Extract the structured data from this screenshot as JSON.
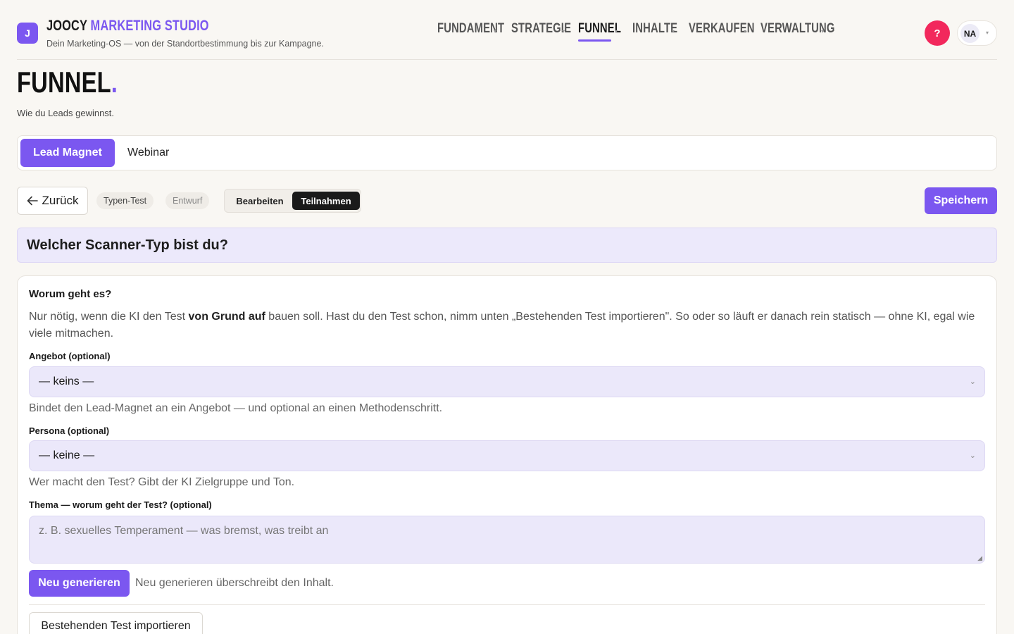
{
  "header": {
    "logo_letter": "J",
    "brand_part1": "Joocy",
    "brand_part2": "Marketing Studio",
    "subtitle": "Dein Marketing-OS — von der Standortbestimmung bis zur Kampagne.",
    "nav": [
      "Fundament",
      "Strategie",
      "Funnel",
      "Inhalte",
      "Verkaufen",
      "Verwaltung"
    ],
    "active_nav": "Funnel",
    "help_label": "?",
    "user_initials": "NA"
  },
  "page": {
    "title": "Funnel",
    "title_dot": ".",
    "subtitle": "Wie du Leads gewinnst."
  },
  "tabs": {
    "items": [
      "Lead Magnet",
      "Webinar"
    ],
    "active": "Lead Magnet"
  },
  "toolbar": {
    "back_label": "Zurück",
    "type_pill": "Typen-Test",
    "status_pill": "Entwurf",
    "segment": [
      "Bearbeiten",
      "Teilnahmen"
    ],
    "segment_active": "Teilnahmen",
    "save_label": "Speichern"
  },
  "question": {
    "title": "Welcher Scanner-Typ bist du?"
  },
  "card": {
    "title": "Worum geht es?",
    "desc_part1": "Nur nötig, wenn die KI den Test ",
    "desc_bold": "von Grund auf",
    "desc_part2": " bauen soll. Hast du den Test schon, nimm unten „Bestehenden Test importieren\". So oder so läuft er danach rein statisch — ohne KI, egal wie viele mitmachen.",
    "offer_label": "Angebot (optional)",
    "offer_value": "— keins —",
    "offer_hint": "Bindet den Lead-Magnet an ein Angebot — und optional an einen Methodenschritt.",
    "persona_label": "Persona (optional)",
    "persona_value": "— keine —",
    "persona_hint": "Wer macht den Test? Gibt der KI Zielgruppe und Ton.",
    "topic_label": "Thema — worum geht der Test? (optional)",
    "topic_placeholder": "z. B. sexuelles Temperament — was bremst, was treibt an",
    "generate_label": "Neu generieren",
    "generate_hint": "Neu generieren überschreibt den Inhalt.",
    "import_label": "Bestehenden Test importieren"
  },
  "icons": {
    "back": "arrow-left-icon",
    "caret": "caret-down-icon",
    "chevron": "chevron-down-icon",
    "resize": "resize-grip-icon"
  },
  "colors": {
    "accent": "#7b57f0",
    "help": "#f2285c",
    "field_bg": "#ebe8fa",
    "banner_bg": "#ece9fb",
    "page_bg": "#f9f7f3"
  }
}
